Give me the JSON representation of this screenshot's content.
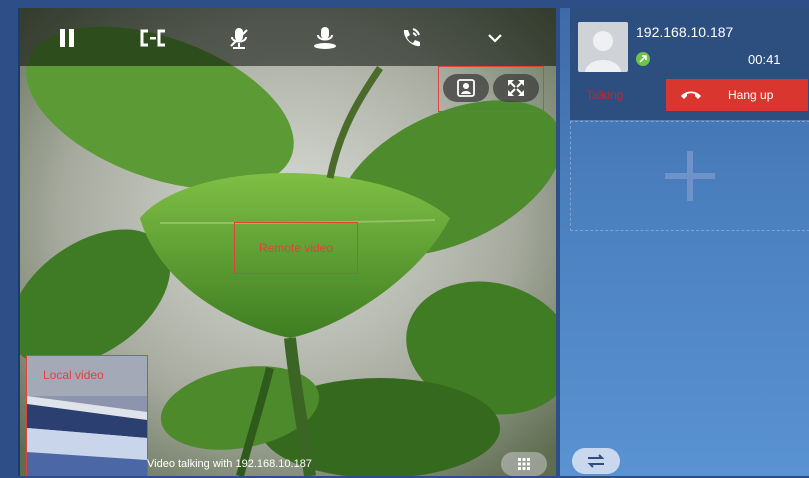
{
  "toolbar": {
    "buttons": [
      {
        "name": "pause-icon"
      },
      {
        "name": "conference-icon"
      },
      {
        "name": "mute-icon"
      },
      {
        "name": "record-icon"
      },
      {
        "name": "transfer-icon"
      },
      {
        "name": "chevron-down-icon"
      }
    ]
  },
  "video": {
    "remote_label": "Remote video",
    "local_label": "Local video",
    "status": "Video talking with 192.168.10.187"
  },
  "call": {
    "caller": "192.168.10.187",
    "timer": "00:41",
    "state": "Talking",
    "hangup_label": "Hang up"
  },
  "colors": {
    "accent_red": "#d9362f",
    "annotation_red": "#e0433a",
    "panel_blue": "#2c4f80",
    "status_green": "#6fc24a"
  }
}
